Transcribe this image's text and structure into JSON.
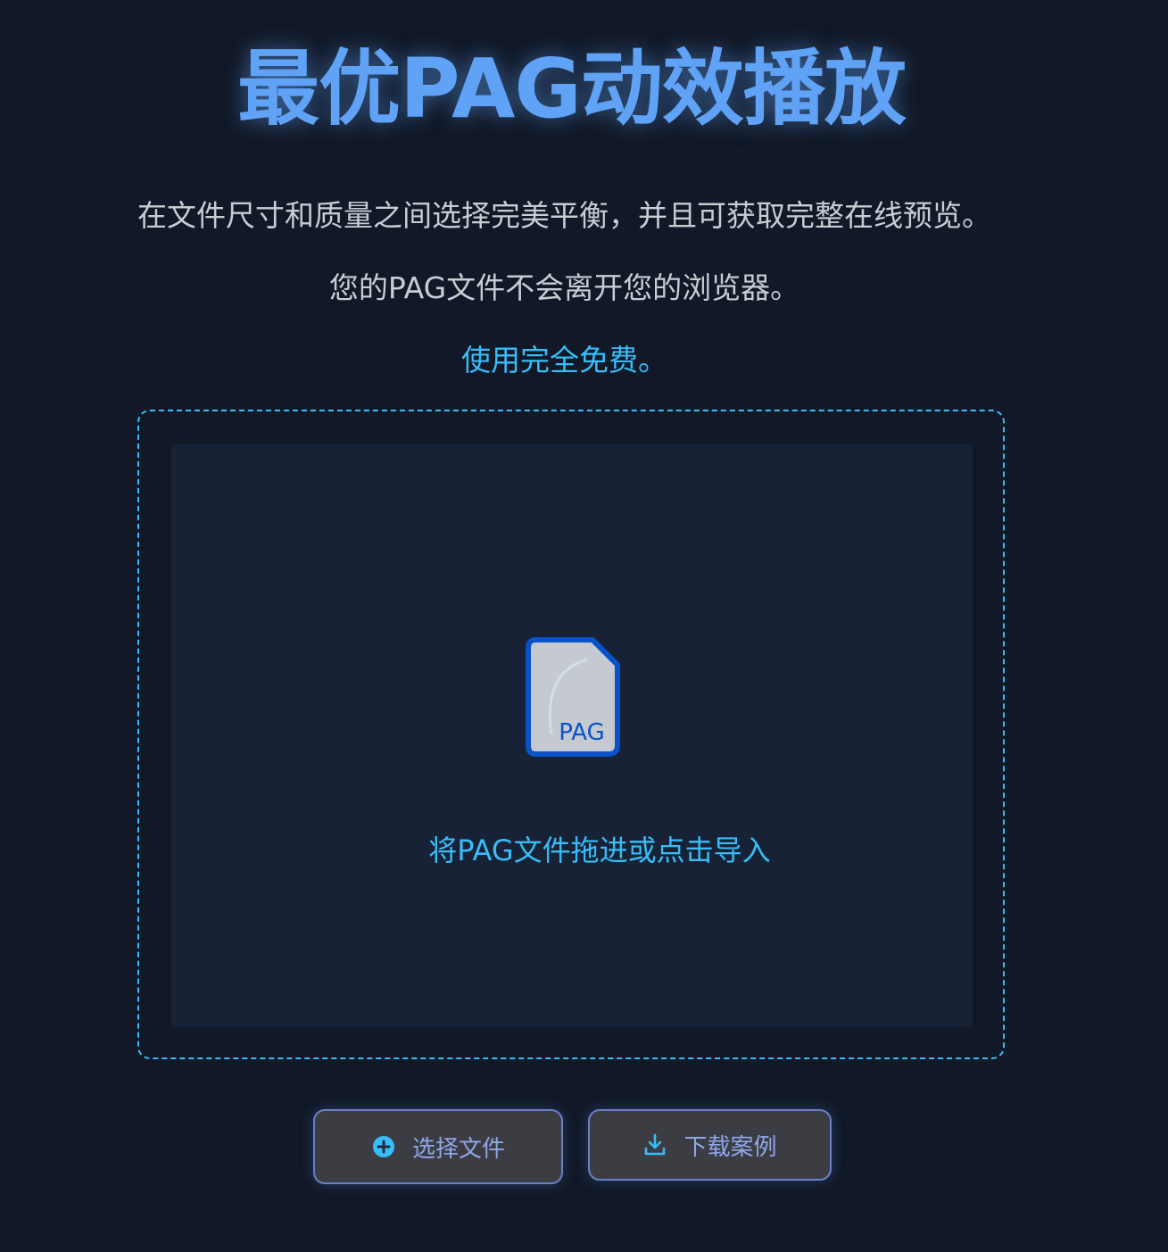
{
  "hero": {
    "title": "最优PAG动效播放",
    "line1": "在文件尺寸和质量之间选择完美平衡，并且可获取完整在线预览。",
    "line2": "您的PAG文件不会离开您的浏览器。",
    "line3": "使用完全免费。"
  },
  "dropzone": {
    "file_icon_label": "PAG",
    "prompt": "将PAG文件拖进或点击导入"
  },
  "actions": {
    "select_file_label": "选择文件",
    "select_file_icon": "plus-circle-icon",
    "download_sample_label": "下载案例",
    "download_sample_icon": "download-icon"
  },
  "colors": {
    "background": "#111827",
    "title": "#5fa2f6",
    "accent": "#38bdf8",
    "dropzone_fill": "#172236",
    "button_bg": "#3c3d42",
    "button_border": "#6a7fc7",
    "button_text": "#8fa6ea"
  }
}
